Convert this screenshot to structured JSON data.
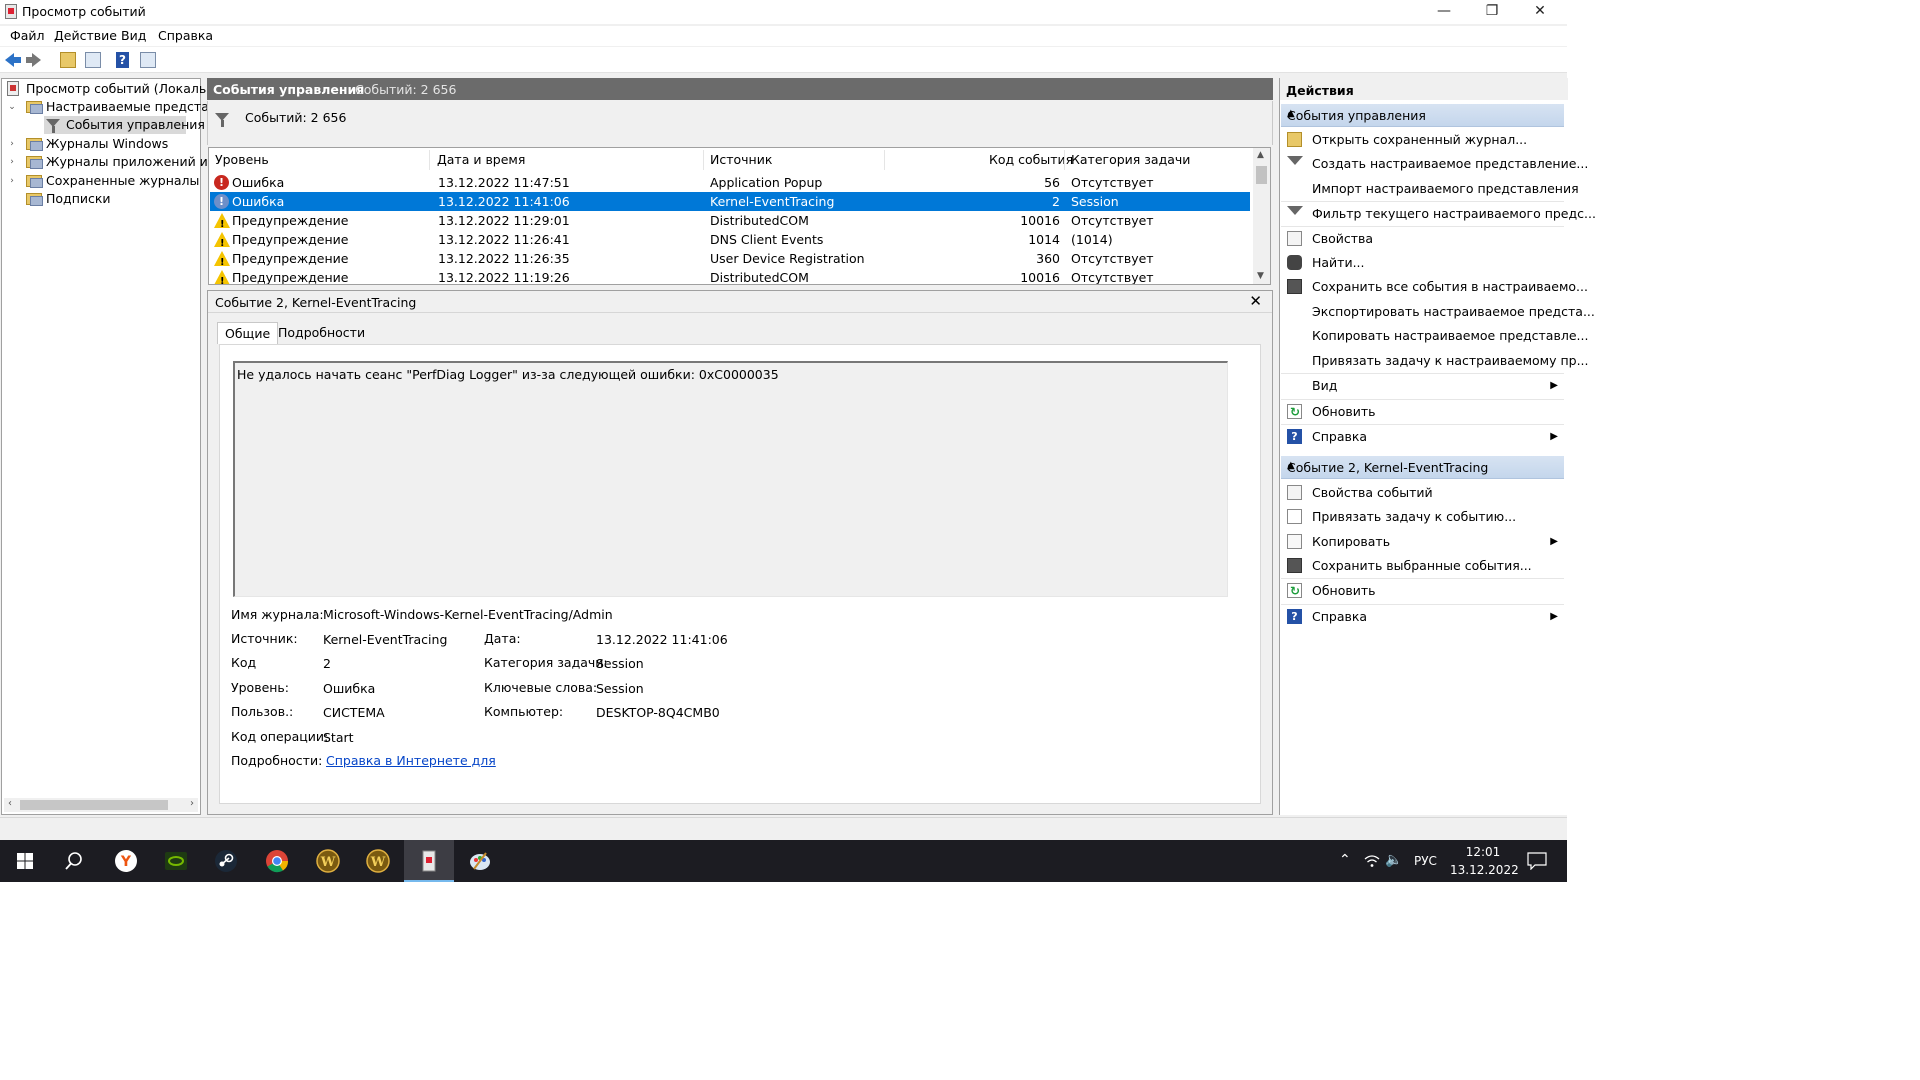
{
  "window": {
    "title": "Просмотр событий"
  },
  "menu": [
    "Файл",
    "Действие",
    "Вид",
    "Справка"
  ],
  "tree": {
    "root": "Просмотр событий (Локальный",
    "custom_views": "Настраиваемые представлен",
    "admin_events": "События управления",
    "windows_logs": "Журналы Windows",
    "app_logs": "Журналы приложений и слу",
    "saved_logs": "Сохраненные журналы",
    "subscriptions": "Подписки"
  },
  "center": {
    "header_title": "События управления",
    "header_count": "Событий: 2 656",
    "filter_count": "Событий: 2 656",
    "columns": [
      "Уровень",
      "Дата и время",
      "Источник",
      "Код события",
      "Категория задачи"
    ],
    "rows": [
      {
        "level": "Ошибка",
        "type": "error",
        "datetime": "13.12.2022 11:47:51",
        "source": "Application Popup",
        "code": "56",
        "category": "Отсутствует"
      },
      {
        "level": "Ошибка",
        "type": "error",
        "datetime": "13.12.2022 11:41:06",
        "source": "Kernel-EventTracing",
        "code": "2",
        "category": "Session"
      },
      {
        "level": "Предупреждение",
        "type": "warning",
        "datetime": "13.12.2022 11:29:01",
        "source": "DistributedCOM",
        "code": "10016",
        "category": "Отсутствует"
      },
      {
        "level": "Предупреждение",
        "type": "warning",
        "datetime": "13.12.2022 11:26:41",
        "source": "DNS Client Events",
        "code": "1014",
        "category": "(1014)"
      },
      {
        "level": "Предупреждение",
        "type": "warning",
        "datetime": "13.12.2022 11:26:35",
        "source": "User Device Registration",
        "code": "360",
        "category": "Отсутствует"
      },
      {
        "level": "Предупреждение",
        "type": "warning",
        "datetime": "13.12.2022 11:19:26",
        "source": "DistributedCOM",
        "code": "10016",
        "category": "Отсутствует"
      }
    ]
  },
  "detail": {
    "title": "Событие 2, Kernel-EventTracing",
    "tab_general": "Общие",
    "tab_details": "Подробности",
    "message": "Не удалось начать сеанс \"PerfDiag Logger\" из-за следующей ошибки: 0xC0000035",
    "log_name_label": "Имя журнала:",
    "log_name": "Microsoft-Windows-Kernel-EventTracing/Admin",
    "source_label": "Источник:",
    "source": "Kernel-EventTracing",
    "date_label": "Дата:",
    "date": "13.12.2022 11:41:06",
    "code_label": "Код",
    "code": "2",
    "task_label": "Категория задачи:",
    "task": "Session",
    "level_label": "Уровень:",
    "level": "Ошибка",
    "keywords_label": "Ключевые слова:",
    "keywords": "Session",
    "user_label": "Пользов.:",
    "user": "СИСТЕМА",
    "computer_label": "Компьютер:",
    "computer": "DESKTOP-8Q4CMB0",
    "opcode_label": "Код операции:",
    "opcode": "Start",
    "more_label": "Подробности:",
    "more_link": "Справка в Интернете для"
  },
  "actions": {
    "title": "Действия",
    "section1": "События управления",
    "section1_items": [
      "Открыть сохраненный журнал...",
      "Создать настраиваемое представление...",
      "Импорт настраиваемого представления",
      "Фильтр текущего настраиваемого предс...",
      "Свойства",
      "Найти...",
      "Сохранить все события в настраиваемо...",
      "Экспортировать настраиваемое предста...",
      "Копировать настраиваемое представле...",
      "Привязать задачу к настраиваемому пр...",
      "Вид",
      "Обновить",
      "Справка"
    ],
    "section2": "Событие 2, Kernel-EventTracing",
    "section2_items": [
      "Свойства событий",
      "Привязать задачу к событию...",
      "Копировать",
      "Сохранить выбранные события...",
      "Обновить",
      "Справка"
    ]
  },
  "taskbar": {
    "lang": "РУС",
    "time": "12:01",
    "date": "13.12.2022",
    "apps": [
      "start-icon",
      "search-icon",
      "yandex-browser-icon",
      "nvidia-icon",
      "steam-icon",
      "chrome-icon",
      "warcraft-icon",
      "warcraft-icon",
      "event-viewer-icon",
      "paint-icon"
    ]
  },
  "colors": {
    "selection": "#0078d7",
    "header_gray": "#6b6b6b",
    "section_blue": "#c4d6ec",
    "taskbar": "#1c1c22"
  }
}
